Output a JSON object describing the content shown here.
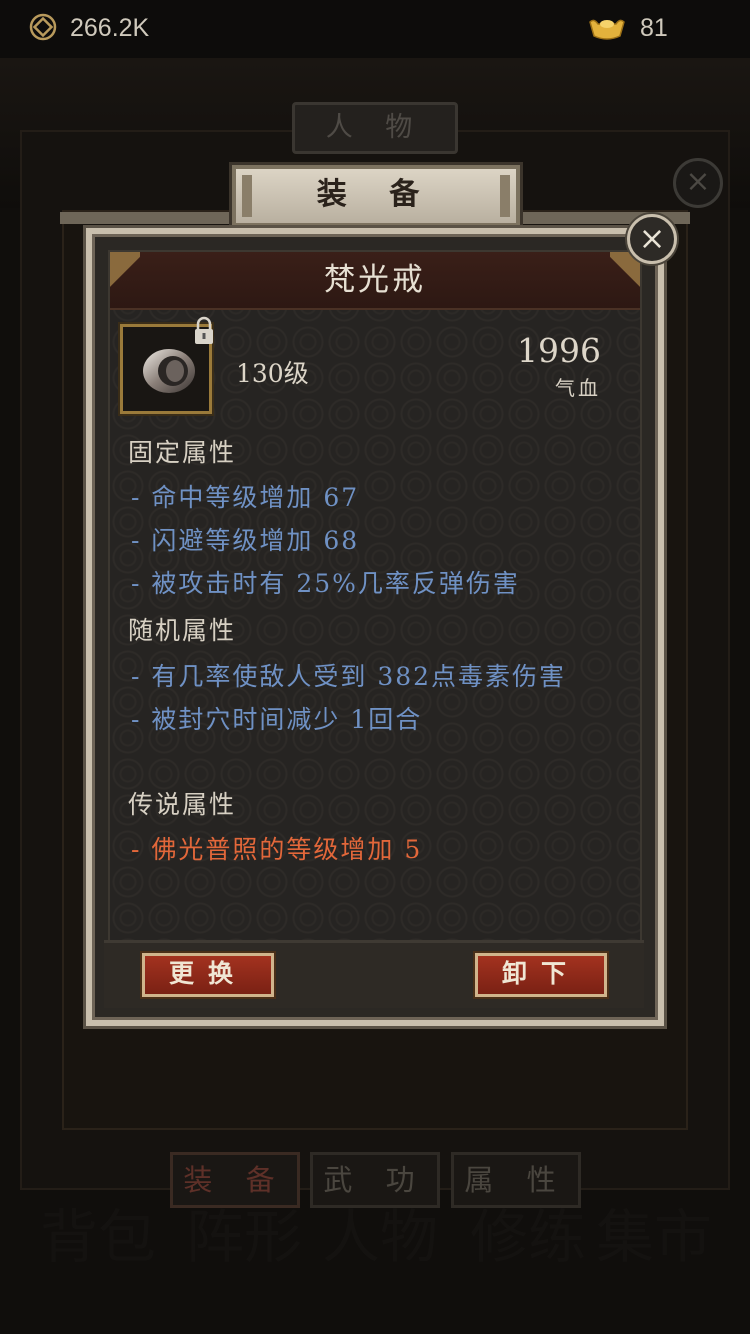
{
  "currency": {
    "coins": "266.2K",
    "ingots": "81"
  },
  "background": {
    "panel_title": "人 物",
    "tabs": [
      "装 备",
      "武 功",
      "属 性"
    ],
    "bottom_nav": [
      "背包",
      "阵形",
      "人物",
      "修练",
      "集市"
    ]
  },
  "equip_header": "装 备",
  "item": {
    "name": "梵光戒",
    "level": "130级",
    "stat_value": "1996",
    "stat_label": "气血",
    "fixed_title": "固定属性",
    "fixed_attrs": [
      "- 命中等级增加 67",
      "- 闪避等级增加 68",
      "- 被攻击时有 25%几率反弹伤害"
    ],
    "random_title": "随机属性",
    "random_attrs": [
      "- 有几率使敌人受到 382点毒素伤害",
      "- 被封穴时间减少 1回合"
    ],
    "legend_title": "传说属性",
    "legend_attrs": [
      "- 佛光普照的等级增加 5"
    ]
  },
  "buttons": {
    "swap": "更换",
    "unequip": "卸下"
  },
  "colors": {
    "attr_blue": "#6f91c4",
    "attr_orange": "#e2673a",
    "button_red": "#a3321f"
  }
}
